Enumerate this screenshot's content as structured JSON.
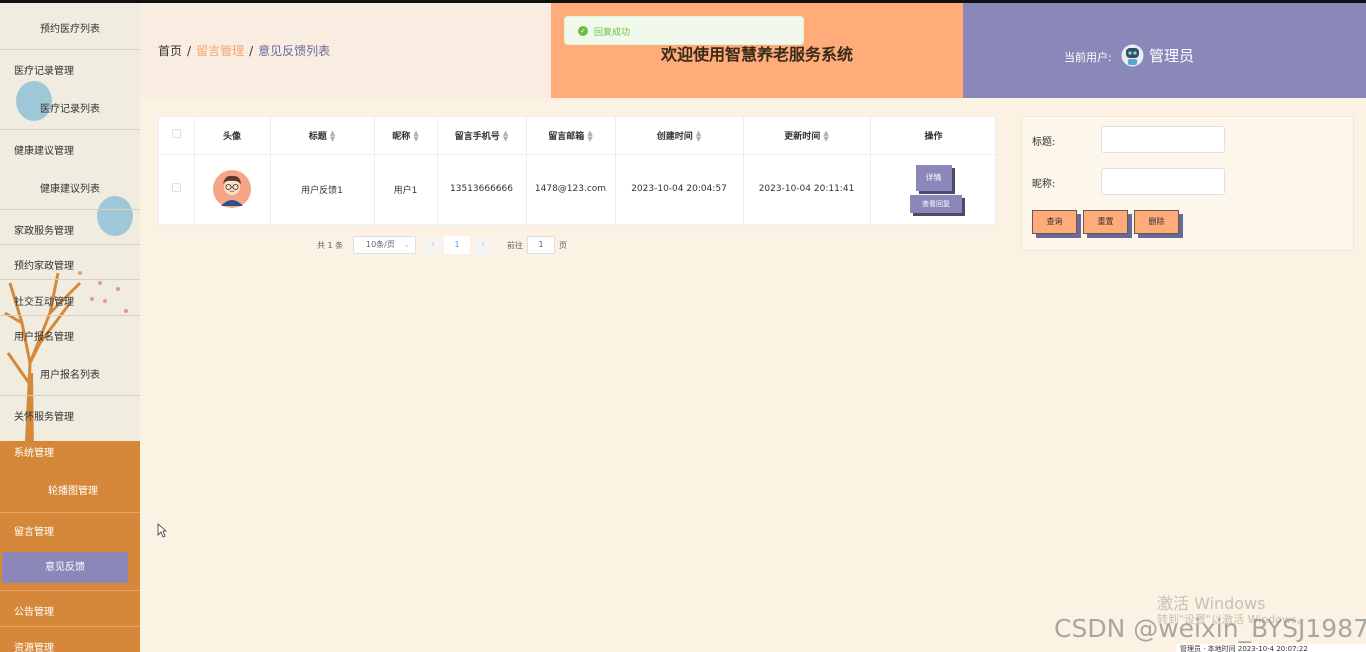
{
  "sidebar": {
    "items": [
      {
        "label": "预约医疗列表",
        "kind": "sub"
      },
      {
        "label": "医疗记录管理",
        "kind": "group"
      },
      {
        "label": "医疗记录列表",
        "kind": "sub"
      },
      {
        "label": "健康建议管理",
        "kind": "group"
      },
      {
        "label": "健康建议列表",
        "kind": "sub"
      },
      {
        "label": "家政服务管理",
        "kind": "group"
      },
      {
        "label": "预约家政管理",
        "kind": "group"
      },
      {
        "label": "社交互动管理",
        "kind": "group"
      },
      {
        "label": "用户报名管理",
        "kind": "group"
      },
      {
        "label": "用户报名列表",
        "kind": "sub"
      },
      {
        "label": "关怀服务管理",
        "kind": "group"
      },
      {
        "label": "系统管理",
        "kind": "group"
      },
      {
        "label": "轮播图管理",
        "kind": "sub"
      },
      {
        "label": "留言管理",
        "kind": "group"
      },
      {
        "label": "意见反馈",
        "kind": "sub",
        "active": true
      },
      {
        "label": "公告管理",
        "kind": "group"
      },
      {
        "label": "资源管理",
        "kind": "group"
      }
    ]
  },
  "header": {
    "breadcrumb": {
      "home": "首页",
      "sep": "/",
      "section": "留言管理",
      "current": "意见反馈列表"
    },
    "title": "欢迎使用智慧养老服务系统",
    "user_label": "当前用户:",
    "user_name": "管理员"
  },
  "toast": {
    "text": "回复成功"
  },
  "table": {
    "columns": [
      "头像",
      "标题",
      "昵称",
      "留言手机号",
      "留言邮箱",
      "创建时间",
      "更新时间",
      "操作"
    ],
    "rows": [
      {
        "title": "用户反馈1",
        "nickname": "用户1",
        "phone": "13513666666",
        "email": "1478@123.com",
        "created": "2023-10-04 20:04:57",
        "updated": "2023-10-04 20:11:41",
        "detail_label": "详情",
        "reply_label": "查看回复"
      }
    ]
  },
  "pagination": {
    "total": "共 1 条",
    "page_size": "10条/页",
    "prev": "‹",
    "current_page": "1",
    "next": "›",
    "goto_label": "前往",
    "goto_value": "1",
    "page_suffix": "页"
  },
  "search": {
    "title_label": "标题:",
    "title_value": "",
    "nickname_label": "昵称:",
    "nickname_value": "",
    "query_label": "查询",
    "reset_label": "重置",
    "delete_label": "删除"
  },
  "watermarks": {
    "activate_title": "激活 Windows",
    "activate_sub": "转到\"设置\"以激活 Windows。",
    "csdn": "CSDN @weixin_BYSJ1987",
    "footer": "管理员 · 本地时间 2023-10-4 20:07:22"
  },
  "colors": {
    "page_bg": "#fbf2e3",
    "header_orange": "#ffab7a",
    "header_purple": "#8a88b8",
    "sidebar_orange": "#d6883a",
    "active_purple": "#8b87b8",
    "button_orange": "#ffab7a"
  }
}
